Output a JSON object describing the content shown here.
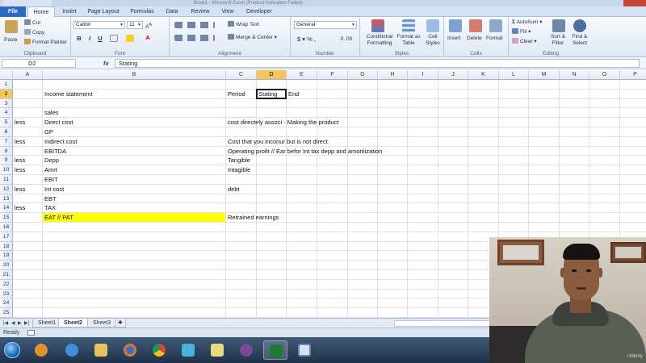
{
  "window": {
    "title": "Book1 - Microsoft Excel (Product Activation Failed)"
  },
  "ribbon_tabs": [
    "File",
    "Home",
    "Insert",
    "Page Layout",
    "Formulas",
    "Data",
    "Review",
    "View",
    "Developer"
  ],
  "ribbon": {
    "clipboard": {
      "paste": "Paste",
      "cut": "Cut",
      "copy": "Copy",
      "format_painter": "Format Painter",
      "label": "Clipboard"
    },
    "font": {
      "name": "Calibri",
      "size": "11",
      "label": "Font"
    },
    "alignment": {
      "wrap_text": "Wrap Text",
      "merge_center": "Merge & Center",
      "label": "Alignment"
    },
    "number": {
      "format": "General",
      "label": "Number"
    },
    "styles": {
      "conditional": "Conditional Formatting",
      "format_table": "Format as Table",
      "cell_styles": "Cell Styles",
      "label": "Styles"
    },
    "cells": {
      "insert": "Insert",
      "delete": "Delete",
      "format": "Format",
      "label": "Cells"
    },
    "editing": {
      "autosum": "AutoSum",
      "fill": "Fill",
      "clear": "Clear",
      "sort_filter": "Sort & Filter",
      "find_select": "Find & Select",
      "label": "Editing"
    }
  },
  "formula_bar": {
    "name_box": "D2",
    "fx": "fx",
    "content": "Stating"
  },
  "grid": {
    "columns": [
      "A",
      "B",
      "C",
      "D",
      "E",
      "F",
      "G",
      "H",
      "I",
      "J",
      "K",
      "L",
      "M",
      "N",
      "O",
      "P"
    ],
    "rows": [
      "1",
      "2",
      "3",
      "4",
      "5",
      "6",
      "7",
      "8",
      "9",
      "10",
      "11",
      "12",
      "13",
      "14",
      "15",
      "16",
      "17",
      "18",
      "19",
      "20",
      "21",
      "22",
      "23",
      "24",
      "25"
    ],
    "selected_cell": "D2",
    "highlight_color": "#ffff00",
    "cells": {
      "B2": "Income statement",
      "C2": "Period",
      "D2": "Stating",
      "E2": "End",
      "B4": "sales",
      "A5": "less",
      "B5": "Direct cost",
      "C5": "cost directely associ - Making the product",
      "B6": "GP",
      "A7": "less",
      "B7": "Indirect cost",
      "C7": "Cost that you inconur but is not direct",
      "B8": "EBITDA",
      "C8": "Operating profit // Ear befor Int tax depp and amortiization",
      "A9": "less",
      "B9": "Depp",
      "C9": "Tangible",
      "A10": "less",
      "B10": "Amrt",
      "C10": "Intagible",
      "B11": "EBIT",
      "A12": "less",
      "B12": "Int cost",
      "C12": "debt",
      "B13": "EBT",
      "A14": "less",
      "B14": "TAX",
      "B15": "EAT // PAT",
      "C15": "Retrained earnings"
    }
  },
  "sheets": [
    "Sheet1",
    "Sheet2",
    "Sheet3"
  ],
  "active_sheet": "Sheet2",
  "status": "Ready",
  "taskbar_apps": [
    "start",
    "media-player",
    "internet-explorer",
    "file-explorer",
    "firefox",
    "chrome",
    "snipping-tool",
    "sticky-notes",
    "tor",
    "excel",
    "presentation"
  ],
  "webcam": {
    "watermark": "Udemy"
  }
}
